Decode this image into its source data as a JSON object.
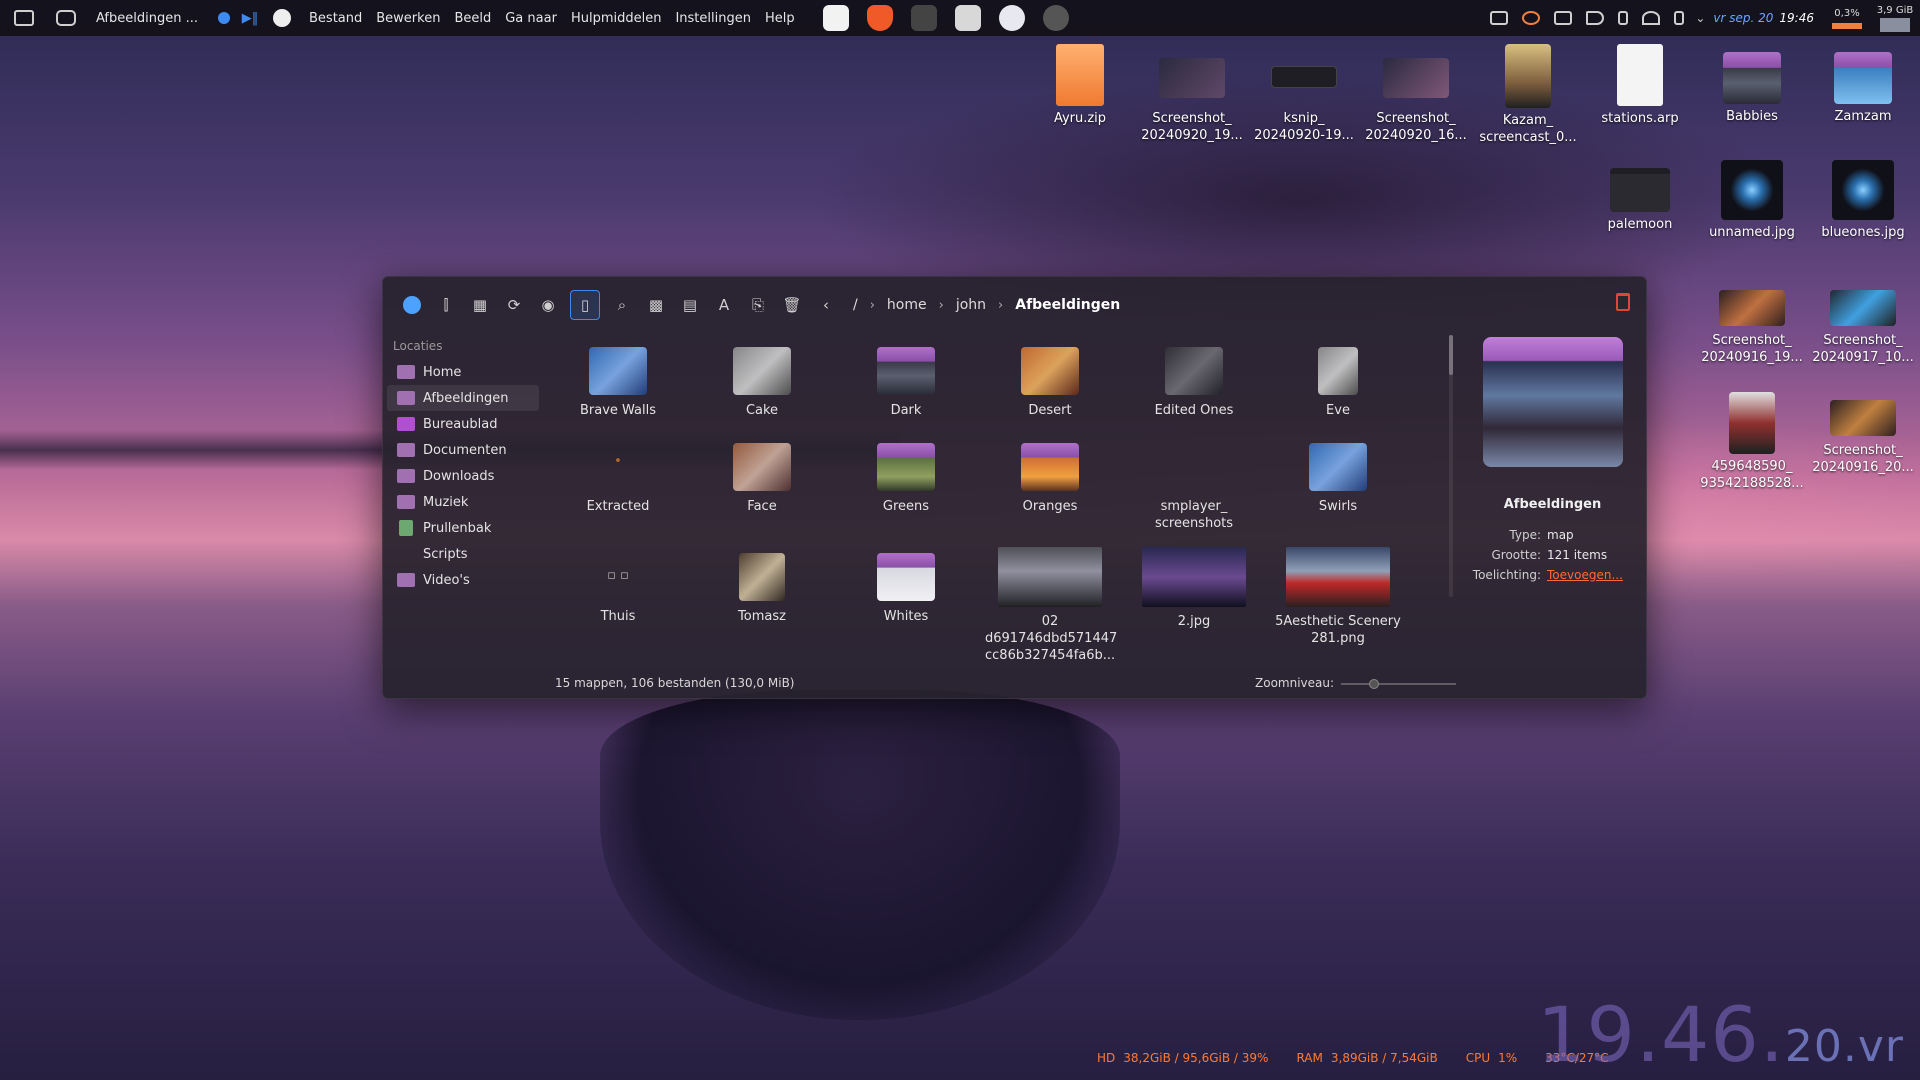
{
  "panel": {
    "active_window": "Afbeeldingen ...",
    "menu": [
      "Bestand",
      "Bewerken",
      "Beeld",
      "Ga naar",
      "Hulpmiddelen",
      "Instellingen",
      "Help"
    ],
    "tray": {
      "date": "vr sep. 20",
      "time": "19:46",
      "cpu_mini": "0,3%",
      "ram_mini": "3,9 GiB"
    }
  },
  "desktop": {
    "icons": [
      {
        "label": "Ayru.zip"
      },
      {
        "label": "Screenshot_ 20240920_19..."
      },
      {
        "label": "ksnip_ 20240920-19..."
      },
      {
        "label": "Screenshot_ 20240920_16..."
      },
      {
        "label": "Kazam_ screencast_0..."
      },
      {
        "label": "stations.arp"
      },
      {
        "label": "Babbies"
      },
      {
        "label": "Zamzam"
      },
      {
        "label": "palemoon"
      },
      {
        "label": "unnamed.jpg"
      },
      {
        "label": "blueones.jpg"
      },
      {
        "label": "Screenshot_ 20240916_19..."
      },
      {
        "label": "Screenshot_ 20240917_10..."
      },
      {
        "label": "459648590_ 93542188528..."
      },
      {
        "label": "Screenshot_ 20240916_20..."
      }
    ]
  },
  "filemanager": {
    "breadcrumb": [
      "/",
      "home",
      "john",
      "Afbeeldingen"
    ],
    "sidebar": {
      "section": "Locaties",
      "items": [
        "Home",
        "Afbeeldingen",
        "Bureaublad",
        "Documenten",
        "Downloads",
        "Muziek",
        "Prullenbak",
        "Scripts",
        "Video's"
      ]
    },
    "items": [
      {
        "label": "Brave Walls"
      },
      {
        "label": "Cake"
      },
      {
        "label": "Dark"
      },
      {
        "label": "Desert"
      },
      {
        "label": "Edited Ones"
      },
      {
        "label": "Eve"
      },
      {
        "label": "Extracted"
      },
      {
        "label": "Face"
      },
      {
        "label": "Greens"
      },
      {
        "label": "Oranges"
      },
      {
        "label": "smplayer_ screenshots"
      },
      {
        "label": "Swirls"
      },
      {
        "label": "Thuis"
      },
      {
        "label": "Tomasz"
      },
      {
        "label": "Whites"
      },
      {
        "label": "02 d691746dbd571447 cc86b327454fa6b..."
      },
      {
        "label": "2.jpg"
      },
      {
        "label": "5Aesthetic Scenery 281.png"
      }
    ],
    "info": {
      "title": "Afbeeldingen",
      "type_label": "Type:",
      "type_value": "map",
      "size_label": "Grootte:",
      "size_value": "121 items",
      "note_label": "Toelichting:",
      "note_value": "Toevoegen..."
    },
    "status": {
      "summary": "15 mappen, 106 bestanden (130,0 MiB)",
      "zoom_label": "Zoomniveau:"
    }
  },
  "sysmon": {
    "hd_label": "HD",
    "hd_value": "38,2GiB / 95,6GiB / 39%",
    "ram_label": "RAM",
    "ram_value": "3,89GiB / 7,54GiB",
    "cpu_label": "CPU",
    "cpu_value": "1%",
    "temp": "33°C/27°C"
  },
  "clock": {
    "main": "19.46.",
    "sub": "20.vr"
  }
}
